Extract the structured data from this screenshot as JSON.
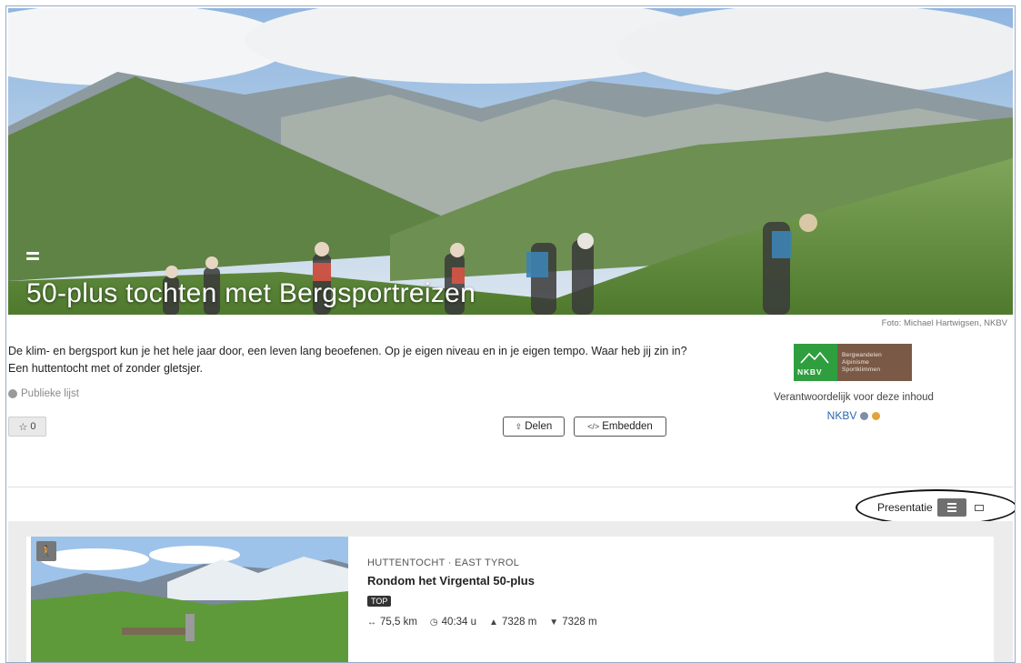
{
  "hero": {
    "title": "50-plus tochten met Bergsportreizen",
    "list_icon": "list-icon",
    "photo_credit": "Foto: Michael Hartwigsen, NKBV"
  },
  "intro": {
    "description": "De klim- en bergsport kun je het hele jaar door, een leven lang beoefenen. Op je eigen niveau en in je eigen tempo. Waar heb jij zin in? Een huttentocht met of zonder gletsjer.",
    "visibility": "Publieke lijst"
  },
  "actions": {
    "star_count": "0",
    "share_label": "Delen",
    "embed_label": "Embedden"
  },
  "organization": {
    "logo_abbr": "NKBV",
    "logo_lines": [
      "Bergwandelen",
      "Alpinisme",
      "Sportklimmen"
    ],
    "responsible_text": "Verantwoordelijk voor deze inhoud",
    "name": "NKBV",
    "colors": {
      "logo_green": "#2f9e3f",
      "logo_brown": "#7a5a47",
      "link": "#2a66b3"
    }
  },
  "presentation": {
    "label": "Presentatie",
    "active_view": "list"
  },
  "tours": [
    {
      "category": "HUTTENTOCHT · EAST TYROL",
      "title": "Rondom het Virgental 50-plus",
      "badge": "TOP",
      "distance": "75,5 km",
      "duration": "40:34 u",
      "ascent": "7328 m",
      "descent": "7328 m",
      "type_icon": "hiker-icon"
    }
  ]
}
